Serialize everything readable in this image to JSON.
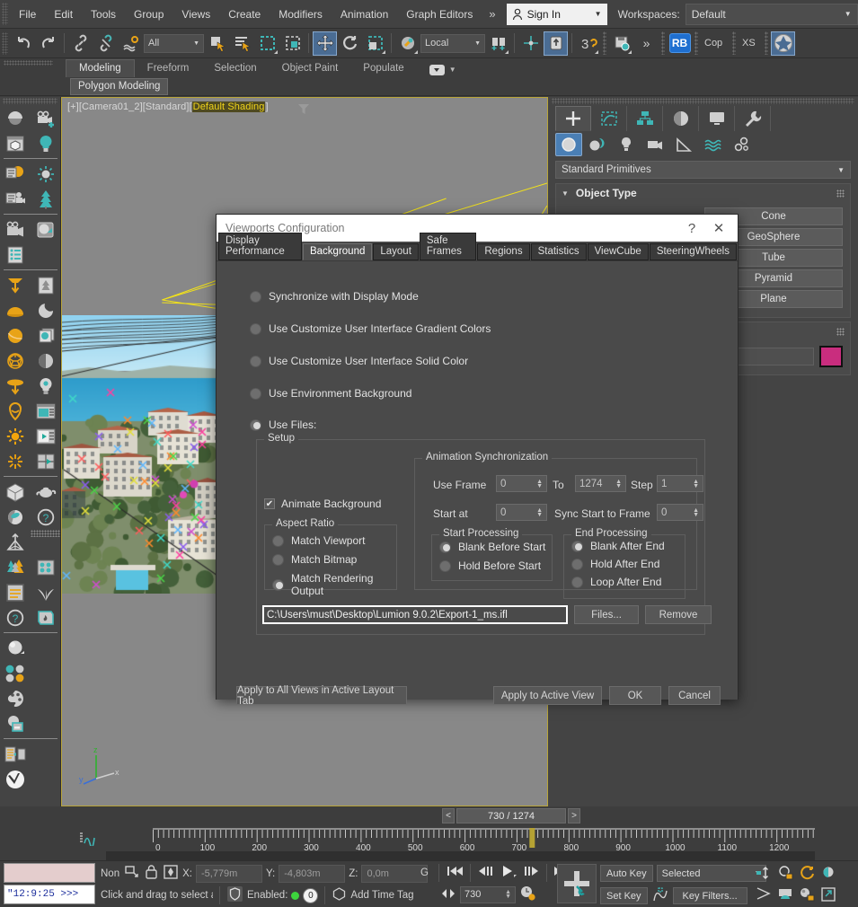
{
  "menubar": {
    "items": [
      "File",
      "Edit",
      "Tools",
      "Group",
      "Views",
      "Create",
      "Modifiers",
      "Animation",
      "Graph Editors"
    ],
    "overflow": "»",
    "signin_label": "Sign In",
    "workspaces_label": "Workspaces:",
    "workspace_value": "Default"
  },
  "toolbar": {
    "selection_filter": "All",
    "reference_coord": "Local",
    "rb_badge": "RB",
    "script_labels": [
      "Cop",
      "XS"
    ],
    "overflow": "»",
    "icons": [
      "undo-icon",
      "redo-icon",
      "select-link-icon",
      "unlink-icon",
      "bind-space-warp-icon",
      "select-object-icon",
      "select-by-name-icon",
      "rectangular-select-icon",
      "window-crossing-icon",
      "select-and-move-icon",
      "select-and-rotate-icon",
      "select-and-scale-icon",
      "select-and-place-icon",
      "use-pivot-center-icon",
      "mirror-icon",
      "align-icon",
      "layer-explorer-icon",
      "curve-editor-icon",
      "render-setup-icon"
    ]
  },
  "ribbon": {
    "tabs": [
      "Modeling",
      "Freeform",
      "Selection",
      "Object Paint",
      "Populate"
    ],
    "active_tab": "Modeling",
    "panel_label": "Polygon Modeling"
  },
  "viewport": {
    "label_prefix": "[+][Camera01_2][Standard][",
    "label_shading": "Default Shading",
    "label_suffix": "]",
    "wire_color": "#f2e21a",
    "background_color": "#888888",
    "border_color": "#b9a53a"
  },
  "command_panel": {
    "tabs": [
      "create-tab",
      "modify-tab",
      "hierarchy-tab",
      "motion-tab",
      "display-tab",
      "utilities-tab"
    ],
    "active_tab": "create-tab",
    "subtabs": [
      "geometry-icon",
      "shapes-icon",
      "lights-icon",
      "cameras-icon",
      "helpers-icon",
      "space-warps-icon",
      "systems-icon"
    ],
    "active_subtab": "geometry-icon",
    "category": "Standard Primitives",
    "rollout_title": "Object Type",
    "object_buttons": [
      "Cone",
      "GeoSphere",
      "Tube",
      "Pyramid",
      "Plane"
    ],
    "name_color_swatch": "#c92d7e"
  },
  "dialog": {
    "title": "Viewports Configuration",
    "help_label": "?",
    "close_label": "✕",
    "tabs": [
      "Display Performance",
      "Background",
      "Layout",
      "Safe Frames",
      "Regions",
      "Statistics",
      "ViewCube",
      "SteeringWheels"
    ],
    "active_tab": "Background",
    "radios": [
      {
        "label": "Synchronize with Display Mode",
        "selected": false
      },
      {
        "label": "Use Customize User Interface Gradient Colors",
        "selected": false
      },
      {
        "label": "Use Customize User Interface Solid Color",
        "selected": false
      },
      {
        "label": "Use Environment Background",
        "selected": false
      },
      {
        "label": "Use Files:",
        "selected": true
      }
    ],
    "setup_group": "Setup",
    "animate_background": {
      "label": "Animate Background",
      "checked": true,
      "mark": "✔"
    },
    "aspect_ratio": {
      "group": "Aspect Ratio",
      "options": [
        {
          "label": "Match Viewport",
          "selected": false
        },
        {
          "label": "Match Bitmap",
          "selected": false
        },
        {
          "label": "Match Rendering Output",
          "selected": true
        }
      ]
    },
    "animation_sync": {
      "group": "Animation Synchronization",
      "use_frame_label": "Use Frame",
      "use_frame_value": "0",
      "to_label": "To",
      "to_value": "1274",
      "step_label": "Step",
      "step_value": "1",
      "start_at_label": "Start at",
      "start_at_value": "0",
      "sync_start_label": "Sync Start to Frame",
      "sync_start_value": "0"
    },
    "start_processing": {
      "group": "Start Processing",
      "options": [
        {
          "label": "Blank Before Start",
          "selected": true
        },
        {
          "label": "Hold Before Start",
          "selected": false
        }
      ]
    },
    "end_processing": {
      "group": "End Processing",
      "options": [
        {
          "label": "Blank After End",
          "selected": true
        },
        {
          "label": "Hold After End",
          "selected": false
        },
        {
          "label": "Loop After End",
          "selected": false
        }
      ]
    },
    "file_path": "C:\\Users\\must\\Desktop\\Lumion 9.0.2\\Export-1_ms.ifl",
    "files_button": "Files...",
    "remove_button": "Remove",
    "apply_all_button": "Apply to All Views in Active Layout Tab",
    "apply_active_button": "Apply to Active View",
    "ok_button": "OK",
    "cancel_button": "Cancel"
  },
  "timeline": {
    "prev_label": "<",
    "next_label": ">",
    "frame_counter": "730 / 1274",
    "current_frame": 730,
    "total_frames": 1274,
    "tick_labels": [
      "0",
      "100",
      "200",
      "300",
      "400",
      "500",
      "600",
      "700",
      "800",
      "900",
      "1000",
      "1100",
      "1200"
    ],
    "marker_color": "#b5a233"
  },
  "statusbar": {
    "listener_text": "\"12:9:25  >>>",
    "none_label": "Non",
    "x_label": "X:",
    "x_value": "-5,779m",
    "y_label": "Y:",
    "y_value": "-4,803m",
    "z_label": "Z:",
    "z_value": "0,0m",
    "grid_label": "G",
    "prompt": "Click and drag to select an",
    "enabled_label": "Enabled:",
    "enabled_count": "0",
    "add_time_tag": "Add Time Tag",
    "auto_key": "Auto Key",
    "set_key": "Set Key",
    "key_filters": "Key Filters...",
    "selected_mode": "Selected",
    "frame_field": "730"
  }
}
